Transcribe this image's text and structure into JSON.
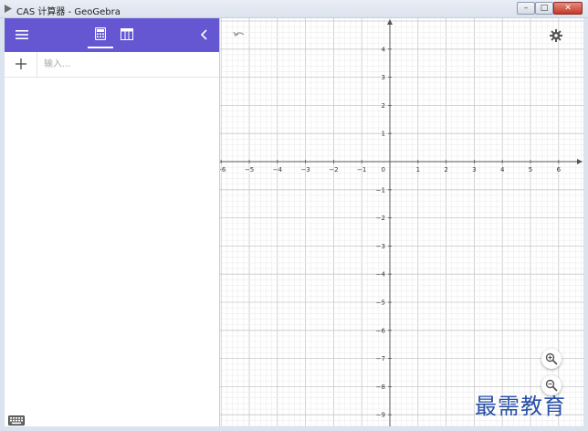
{
  "window": {
    "title": "CAS 计算器 - GeoGebra",
    "minimize_label": "–",
    "maximize_label": "□",
    "close_label": "✕"
  },
  "toolbar": {
    "accent_color": "#6557d2",
    "icons": [
      "menu-icon",
      "calculator-icon",
      "table-icon",
      "chevron-left-icon"
    ]
  },
  "algebra": {
    "input_placeholder": "输入...",
    "input_value": ""
  },
  "graph": {
    "x_ticks": [
      "−6",
      "−5",
      "−4",
      "−3",
      "−2",
      "−1",
      "1",
      "2",
      "3",
      "4",
      "5",
      "6"
    ],
    "y_ticks_positive": [
      "4",
      "3",
      "2",
      "1"
    ],
    "y_ticks_negative": [
      "−1",
      "−2",
      "−3",
      "−4",
      "−5",
      "−6",
      "−7",
      "−8",
      "−9"
    ],
    "origin_label": "0",
    "x_range": [
      -6.2,
      6.6
    ],
    "y_range": [
      -9.5,
      5.1
    ],
    "grid": true
  },
  "watermark": {
    "text": "最需教育"
  }
}
